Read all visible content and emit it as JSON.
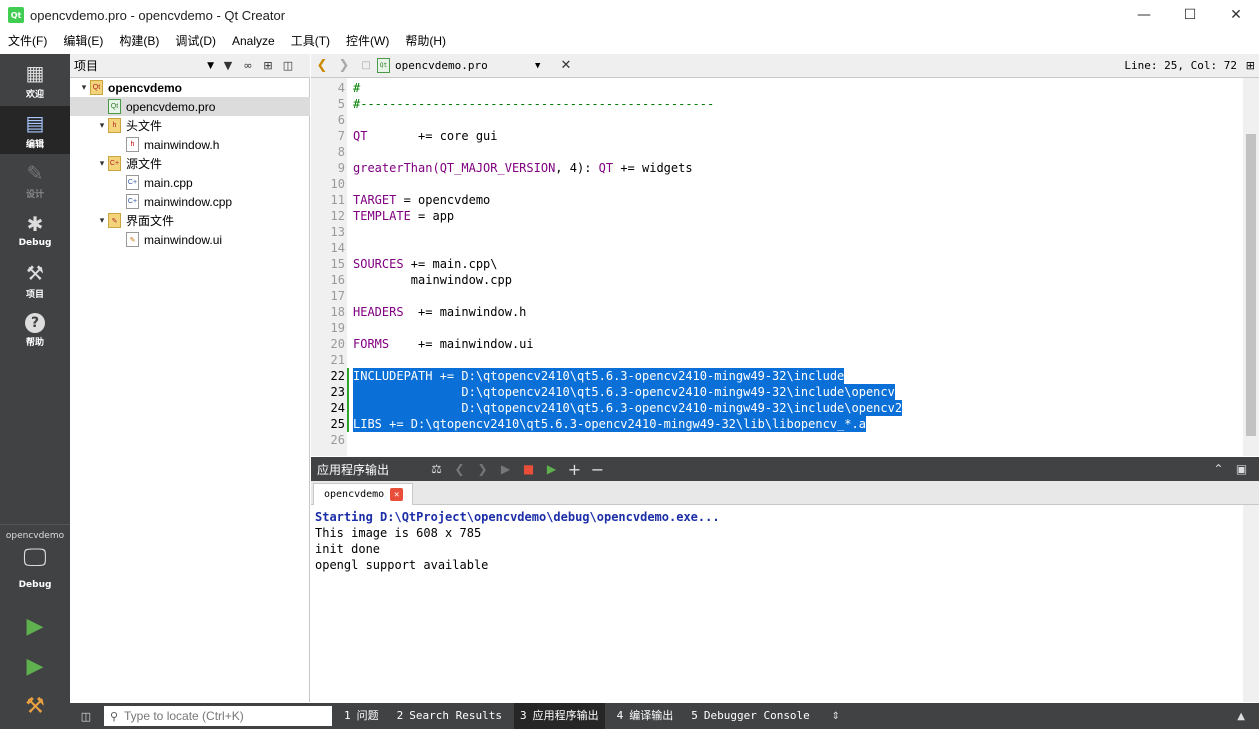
{
  "window": {
    "title": "opencvdemo.pro - opencvdemo - Qt Creator",
    "app_icon_text": "Qt",
    "minimize_icon": "minimize-icon",
    "maximize_icon": "maximize-icon",
    "close_icon": "close-icon"
  },
  "menu": [
    "文件(F)",
    "编辑(E)",
    "构建(B)",
    "调试(D)",
    "Analyze",
    "工具(T)",
    "控件(W)",
    "帮助(H)"
  ],
  "modes": [
    {
      "label": "欢迎",
      "icon": "grid-icon",
      "active": false,
      "disabled": false
    },
    {
      "label": "编辑",
      "icon": "document-icon",
      "active": true,
      "disabled": false
    },
    {
      "label": "设计",
      "icon": "pencil-icon",
      "active": false,
      "disabled": true
    },
    {
      "label": "Debug",
      "icon": "bug-icon",
      "active": false,
      "disabled": false
    },
    {
      "label": "项目",
      "icon": "wrench-icon",
      "active": false,
      "disabled": false
    },
    {
      "label": "帮助",
      "icon": "question-icon",
      "active": false,
      "disabled": false
    }
  ],
  "kit": {
    "project": "opencvdemo",
    "config": "Debug"
  },
  "project_panel": {
    "combo_label": "项目",
    "tree": [
      {
        "label": "opencvdemo",
        "depth": 0,
        "kind": "folder",
        "arrow": "▾",
        "bold": true,
        "selected": false,
        "icon_text": "Qt"
      },
      {
        "label": "opencvdemo.pro",
        "depth": 1,
        "kind": "pro",
        "arrow": "",
        "bold": false,
        "selected": true,
        "icon_text": "Qt"
      },
      {
        "label": "头文件",
        "depth": 1,
        "kind": "folder",
        "arrow": "▾",
        "bold": false,
        "selected": false,
        "icon_text": "h"
      },
      {
        "label": "mainwindow.h",
        "depth": 2,
        "kind": "header",
        "arrow": "",
        "bold": false,
        "selected": false,
        "icon_text": "h"
      },
      {
        "label": "源文件",
        "depth": 1,
        "kind": "folder",
        "arrow": "▾",
        "bold": false,
        "selected": false,
        "icon_text": "C+"
      },
      {
        "label": "main.cpp",
        "depth": 2,
        "kind": "cpp",
        "arrow": "",
        "bold": false,
        "selected": false,
        "icon_text": "C+"
      },
      {
        "label": "mainwindow.cpp",
        "depth": 2,
        "kind": "cpp",
        "arrow": "",
        "bold": false,
        "selected": false,
        "icon_text": "C+"
      },
      {
        "label": "界面文件",
        "depth": 1,
        "kind": "folder",
        "arrow": "▾",
        "bold": false,
        "selected": false,
        "icon_text": "✎"
      },
      {
        "label": "mainwindow.ui",
        "depth": 2,
        "kind": "ui",
        "arrow": "",
        "bold": false,
        "selected": false,
        "icon_text": "✎"
      }
    ]
  },
  "editor": {
    "document": "opencvdemo.pro",
    "line_col": "Line: 25, Col: 72",
    "lines": [
      {
        "n": "4",
        "text": "#",
        "kind": "comment",
        "selected": false,
        "current": false
      },
      {
        "n": "5",
        "text": "#-------------------------------------------------",
        "kind": "comment",
        "selected": false,
        "current": false
      },
      {
        "n": "6",
        "text": "",
        "kind": "plain",
        "selected": false,
        "current": false
      },
      {
        "n": "7",
        "text": "QT       += core gui",
        "kind": "kwline",
        "kw": "QT",
        "rest": "       += core gui",
        "selected": false,
        "current": false
      },
      {
        "n": "8",
        "text": "",
        "kind": "plain",
        "selected": false,
        "current": false
      },
      {
        "n": "9",
        "text": "greaterThan(QT_MAJOR_VERSION, 4): QT += widgets",
        "kind": "fn",
        "selected": false,
        "current": false
      },
      {
        "n": "10",
        "text": "",
        "kind": "plain",
        "selected": false,
        "current": false
      },
      {
        "n": "11",
        "text": "TARGET = opencvdemo",
        "kind": "kwline",
        "kw": "TARGET",
        "rest": " = opencvdemo",
        "selected": false,
        "current": false
      },
      {
        "n": "12",
        "text": "TEMPLATE = app",
        "kind": "kwline",
        "kw": "TEMPLATE",
        "rest": " = app",
        "selected": false,
        "current": false
      },
      {
        "n": "13",
        "text": "",
        "kind": "plain",
        "selected": false,
        "current": false
      },
      {
        "n": "14",
        "text": "",
        "kind": "plain",
        "selected": false,
        "current": false
      },
      {
        "n": "15",
        "text": "SOURCES += main.cpp\\",
        "kind": "kwline",
        "kw": "SOURCES",
        "rest": " += main.cpp\\",
        "selected": false,
        "current": false
      },
      {
        "n": "16",
        "text": "        mainwindow.cpp",
        "kind": "plain",
        "selected": false,
        "current": false
      },
      {
        "n": "17",
        "text": "",
        "kind": "plain",
        "selected": false,
        "current": false
      },
      {
        "n": "18",
        "text": "HEADERS  += mainwindow.h",
        "kind": "kwline",
        "kw": "HEADERS",
        "rest": "  += mainwindow.h",
        "selected": false,
        "current": false
      },
      {
        "n": "19",
        "text": "",
        "kind": "plain",
        "selected": false,
        "current": false
      },
      {
        "n": "20",
        "text": "FORMS    += mainwindow.ui",
        "kind": "kwline",
        "kw": "FORMS",
        "rest": "    += mainwindow.ui",
        "selected": false,
        "current": false
      },
      {
        "n": "21",
        "text": "",
        "kind": "plain",
        "selected": false,
        "current": false
      },
      {
        "n": "22",
        "text": "INCLUDEPATH += D:\\qtopencv2410\\qt5.6.3-opencv2410-mingw49-32\\include",
        "kind": "sel",
        "selected": true,
        "current": true
      },
      {
        "n": "23",
        "text": "               D:\\qtopencv2410\\qt5.6.3-opencv2410-mingw49-32\\include\\opencv",
        "kind": "sel",
        "selected": true,
        "current": true
      },
      {
        "n": "24",
        "text": "               D:\\qtopencv2410\\qt5.6.3-opencv2410-mingw49-32\\include\\opencv2",
        "kind": "sel",
        "selected": true,
        "current": true
      },
      {
        "n": "25",
        "text": "LIBS += D:\\qtopencv2410\\qt5.6.3-opencv2410-mingw49-32\\lib\\libopencv_*.a",
        "kind": "sel",
        "selected": true,
        "current": true
      },
      {
        "n": "26",
        "text": "",
        "kind": "plain",
        "selected": false,
        "current": false
      }
    ]
  },
  "output": {
    "title": "应用程序输出",
    "tab": "opencvdemo",
    "lines": [
      {
        "text": "Starting D:\\QtProject\\opencvdemo\\debug\\opencvdemo.exe...",
        "start": true
      },
      {
        "text": "This image is 608 x 785",
        "start": false
      },
      {
        "text": "init done",
        "start": false
      },
      {
        "text": "opengl support available",
        "start": false
      }
    ]
  },
  "statusbar": {
    "locator_placeholder": "Type to locate (Ctrl+K)",
    "tabs": [
      {
        "num": "1",
        "label": "问题",
        "active": false
      },
      {
        "num": "2",
        "label": "Search Results",
        "active": false
      },
      {
        "num": "3",
        "label": "应用程序输出",
        "active": true
      },
      {
        "num": "4",
        "label": "编译输出",
        "active": false
      },
      {
        "num": "5",
        "label": "Debugger Console",
        "active": false
      }
    ]
  },
  "colors": {
    "keyword": "#800080",
    "comment": "#008000",
    "selection": "#0a6fd6",
    "sidebar": "#404244"
  }
}
